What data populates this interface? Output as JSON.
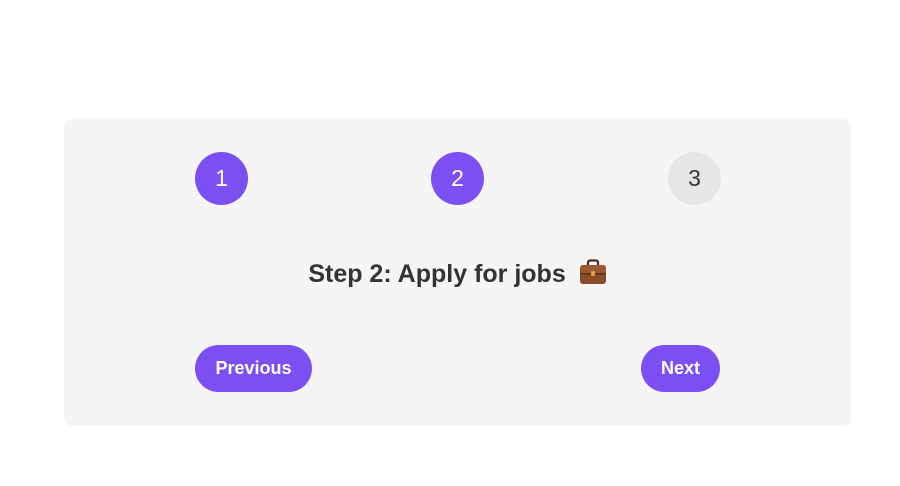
{
  "stepper": {
    "steps": [
      {
        "label": "1",
        "state": "active"
      },
      {
        "label": "2",
        "state": "active"
      },
      {
        "label": "3",
        "state": "inactive"
      }
    ],
    "current_step": 2
  },
  "content": {
    "title": "Step 2: Apply for jobs",
    "title_icon": "briefcase-icon"
  },
  "nav": {
    "previous_label": "Previous",
    "next_label": "Next"
  },
  "colors": {
    "accent": "#7c4ff2",
    "card_bg": "#f6f5f6",
    "inactive_step_bg": "#e7e6e7",
    "text": "#333333"
  }
}
